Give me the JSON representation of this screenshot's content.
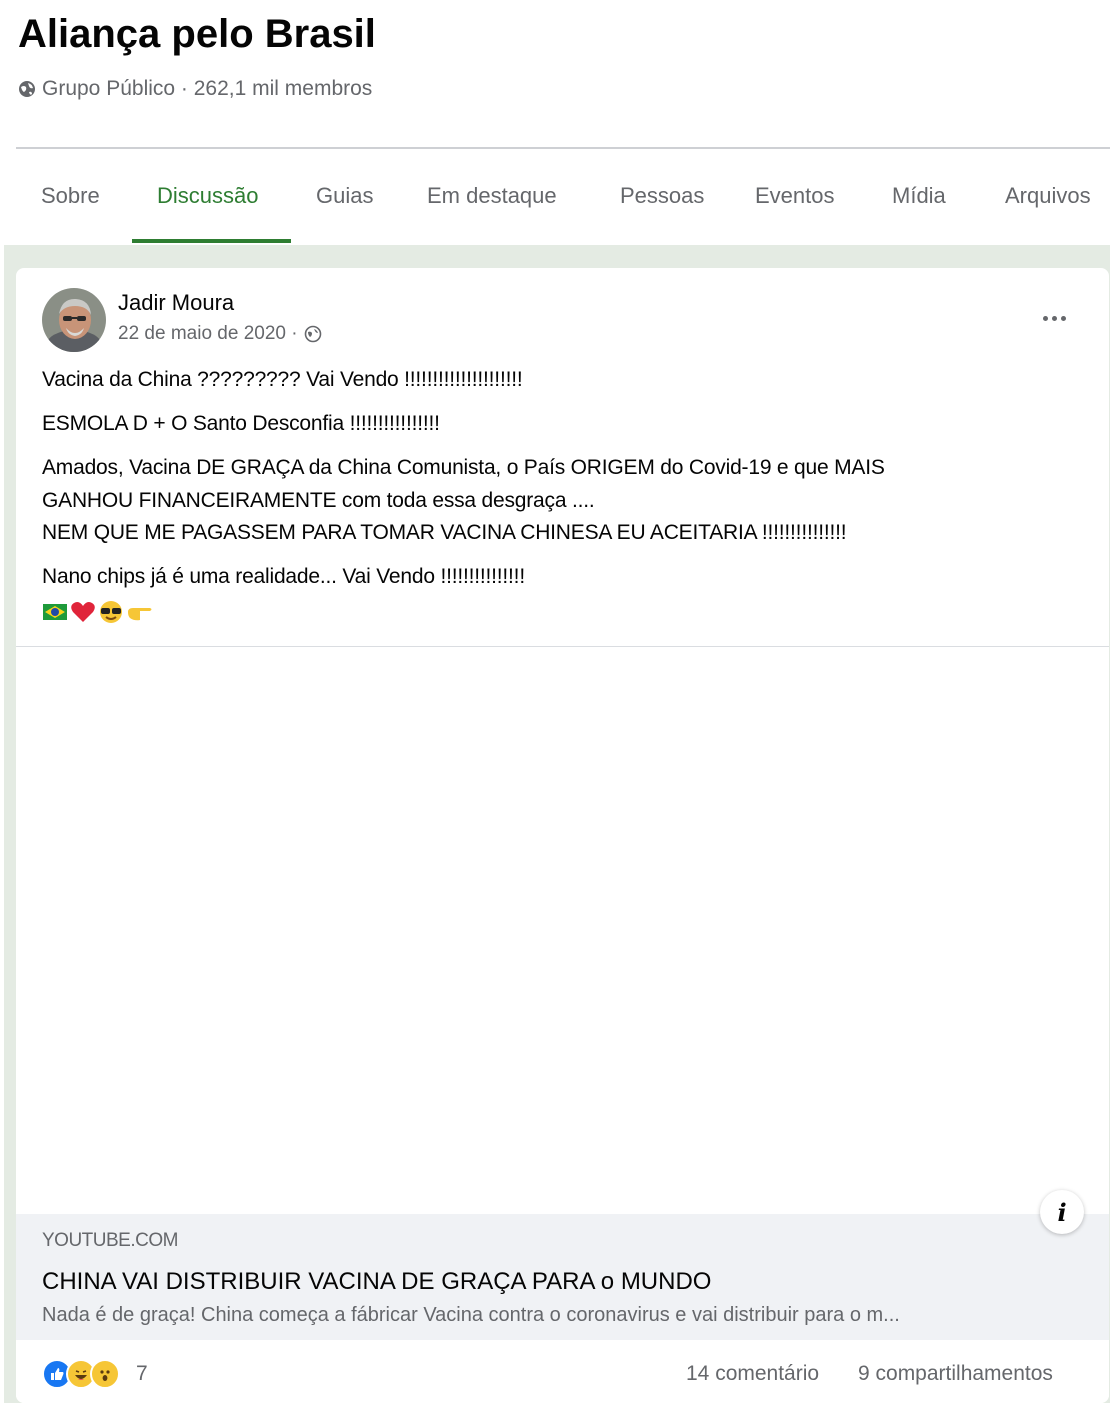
{
  "group": {
    "title": "Aliança pelo Brasil",
    "meta": "Grupo Público · 262,1 mil membros"
  },
  "tabs": [
    {
      "label": "Sobre"
    },
    {
      "label": "Discussão",
      "active": true
    },
    {
      "label": "Guias"
    },
    {
      "label": "Em destaque"
    },
    {
      "label": "Pessoas"
    },
    {
      "label": "Eventos"
    },
    {
      "label": "Mídia"
    },
    {
      "label": "Arquivos"
    }
  ],
  "post": {
    "author": "Jadir Moura",
    "date": "22 de maio de 2020 ·",
    "lines": [
      "Vacina da China ????????? Vai Vendo !!!!!!!!!!!!!!!!!!!!!",
      "ESMOLA D + O Santo Desconfia !!!!!!!!!!!!!!!!",
      "Amados, Vacina DE GRAÇA da China Comunista, o País ORIGEM do Covid-19 e que MAIS",
      "GANHOU FINANCEIRAMENTE com toda essa desgraça ....",
      "NEM QUE ME PAGASSEM PARA TOMAR VACINA CHINESA EU ACEITARIA !!!!!!!!!!!!!!!",
      "Nano chips já é uma realidade...  Vai Vendo !!!!!!!!!!!!!!!"
    ],
    "emojis": [
      "brazil-flag",
      "red-heart",
      "sunglasses-face",
      "pointing-hand"
    ]
  },
  "link": {
    "domain": "YOUTUBE.COM",
    "title": "CHINA VAI DISTRIBUIR VACINA DE GRAÇA PARA o MUNDO",
    "description": "Nada é de graça! China começa a fábricar Vacina contra o coronavirus e vai distribuir para o m...",
    "info_icon": "i"
  },
  "reactions": {
    "icons": [
      "like",
      "haha",
      "wow"
    ],
    "count": "7",
    "comments": "14 comentário",
    "shares": "9 compartilhamentos"
  },
  "colors": {
    "accent": "#2e7d32",
    "feed_background": "#e4ebe3",
    "muted_text": "#65676b"
  }
}
